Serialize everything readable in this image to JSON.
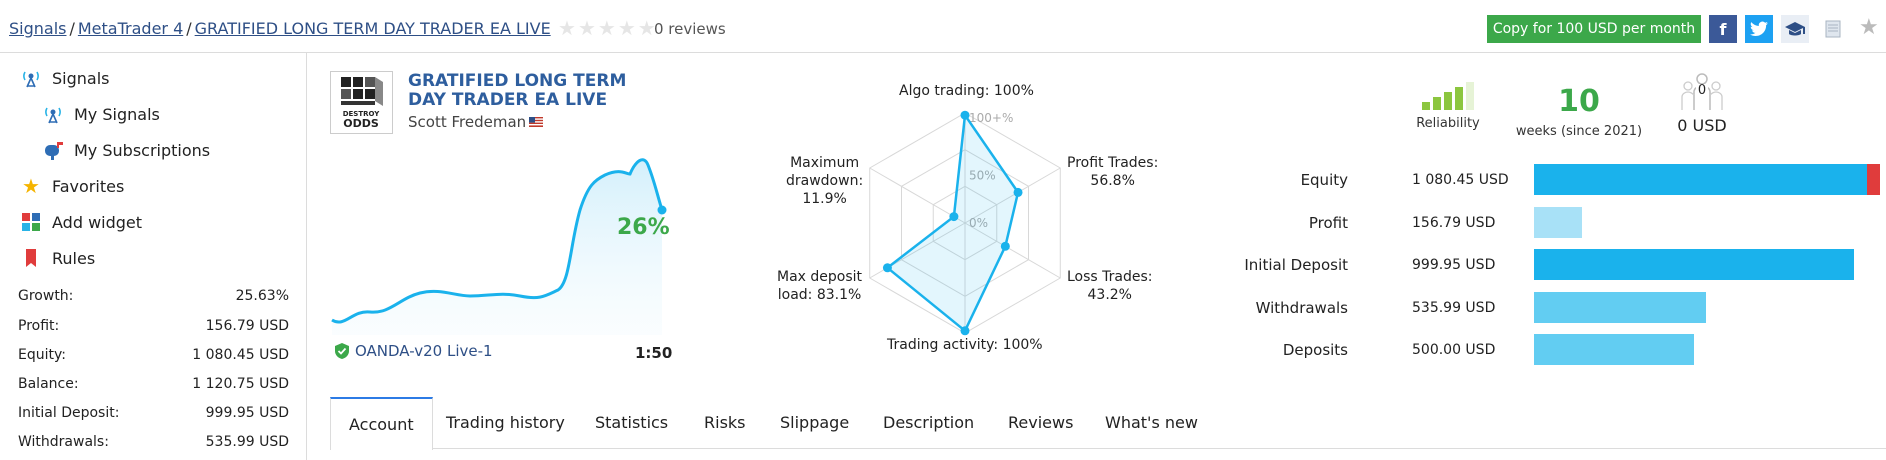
{
  "breadcrumb": {
    "items": [
      "Signals",
      "MetaTrader 4",
      "GRATIFIED LONG TERM DAY TRADER EA LIVE"
    ],
    "separator": "/"
  },
  "rating": {
    "stars": 0,
    "max": 5,
    "reviews_text": "0 reviews"
  },
  "header": {
    "copy_button": "Copy for 100 USD per month"
  },
  "sidebar": {
    "nav": [
      {
        "label": "Signals",
        "icon": "signal-tower-icon"
      },
      {
        "label": "My Signals",
        "icon": "signal-tower-icon"
      },
      {
        "label": "My Subscriptions",
        "icon": "mailbox-icon"
      },
      {
        "label": "Favorites",
        "icon": "star-icon"
      },
      {
        "label": "Add widget",
        "icon": "widget-icon"
      },
      {
        "label": "Rules",
        "icon": "bookmark-icon"
      }
    ],
    "stats": [
      {
        "label": "Growth:",
        "value": "25.63%"
      },
      {
        "label": "Profit:",
        "value": "156.79 USD"
      },
      {
        "label": "Equity:",
        "value": "1 080.45 USD"
      },
      {
        "label": "Balance:",
        "value": "1 120.75 USD"
      },
      {
        "label": "Initial Deposit:",
        "value": "999.95 USD"
      },
      {
        "label": "Withdrawals:",
        "value": "535.99 USD"
      }
    ]
  },
  "signal": {
    "title": "GRATIFIED LONG TERM DAY TRADER EA LIVE",
    "author": "Scott Fredeman",
    "logo_text": [
      "DESTROY",
      "ODDS"
    ],
    "growth": "26%",
    "broker": "OANDA-v20 Live-1",
    "leverage": "1:50"
  },
  "radar": {
    "axes": [
      {
        "label": "Algo trading: 100%",
        "value": 100
      },
      {
        "label": "Profit Trades:\n56.8%",
        "value": 56.8
      },
      {
        "label": "Loss Trades:\n43.2%",
        "value": 43.2
      },
      {
        "label": "Trading activity: 100%",
        "value": 100
      },
      {
        "label": "Max deposit\nload: 83.1%",
        "value": 83.1
      },
      {
        "label": "Maximum\ndrawdown:\n11.9%",
        "value": 11.9
      }
    ],
    "ring_labels": [
      "100+%",
      "50%",
      "0%"
    ]
  },
  "kpis": {
    "reliability_label": "Reliability",
    "weeks": "10",
    "weeks_label": "weeks (since 2021)",
    "subscribers": "0",
    "subscribers_value": "0 USD"
  },
  "bars": [
    {
      "label": "Equity",
      "value": "1 080.45 USD",
      "fraction": 1.0,
      "color": "#1ab2ec",
      "alert_color": "#e03c3c"
    },
    {
      "label": "Profit",
      "value": "156.79 USD",
      "fraction": 0.14,
      "color": "#a8e1f7"
    },
    {
      "label": "Initial Deposit",
      "value": "999.95 USD",
      "fraction": 0.925,
      "color": "#1ab2ec"
    },
    {
      "label": "Withdrawals",
      "value": "535.99 USD",
      "fraction": 0.496,
      "color": "#62cdf2"
    },
    {
      "label": "Deposits",
      "value": "500.00 USD",
      "fraction": 0.463,
      "color": "#62cdf2"
    }
  ],
  "tabs": [
    "Account",
    "Trading history",
    "Statistics",
    "Risks",
    "Slippage",
    "Description",
    "Reviews",
    "What's new"
  ],
  "active_tab": "Account",
  "colors": {
    "link": "#2e4f86",
    "accent_green": "#3ca84a",
    "chart_blue": "#1ab2ec"
  }
}
